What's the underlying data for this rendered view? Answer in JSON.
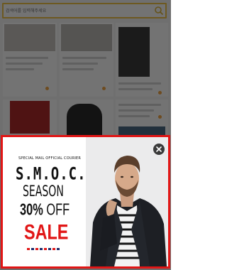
{
  "search": {
    "placeholder": "검색어를 입력해주세요"
  },
  "popup": {
    "subtitle": "SPECIAL MAIL OFFICIAL COURIER",
    "title_line1": "S.M.O.C.",
    "title_line2": "SEASON",
    "title_percent": "30%",
    "title_off": " OFF",
    "title_sale": "SALE"
  },
  "colors": {
    "popup_border": "#e11616",
    "sale_red": "#e11616",
    "search_border": "#f1c64a",
    "accent_dot": "#f4a646"
  },
  "icons": [
    "search-icon",
    "close-icon"
  ]
}
